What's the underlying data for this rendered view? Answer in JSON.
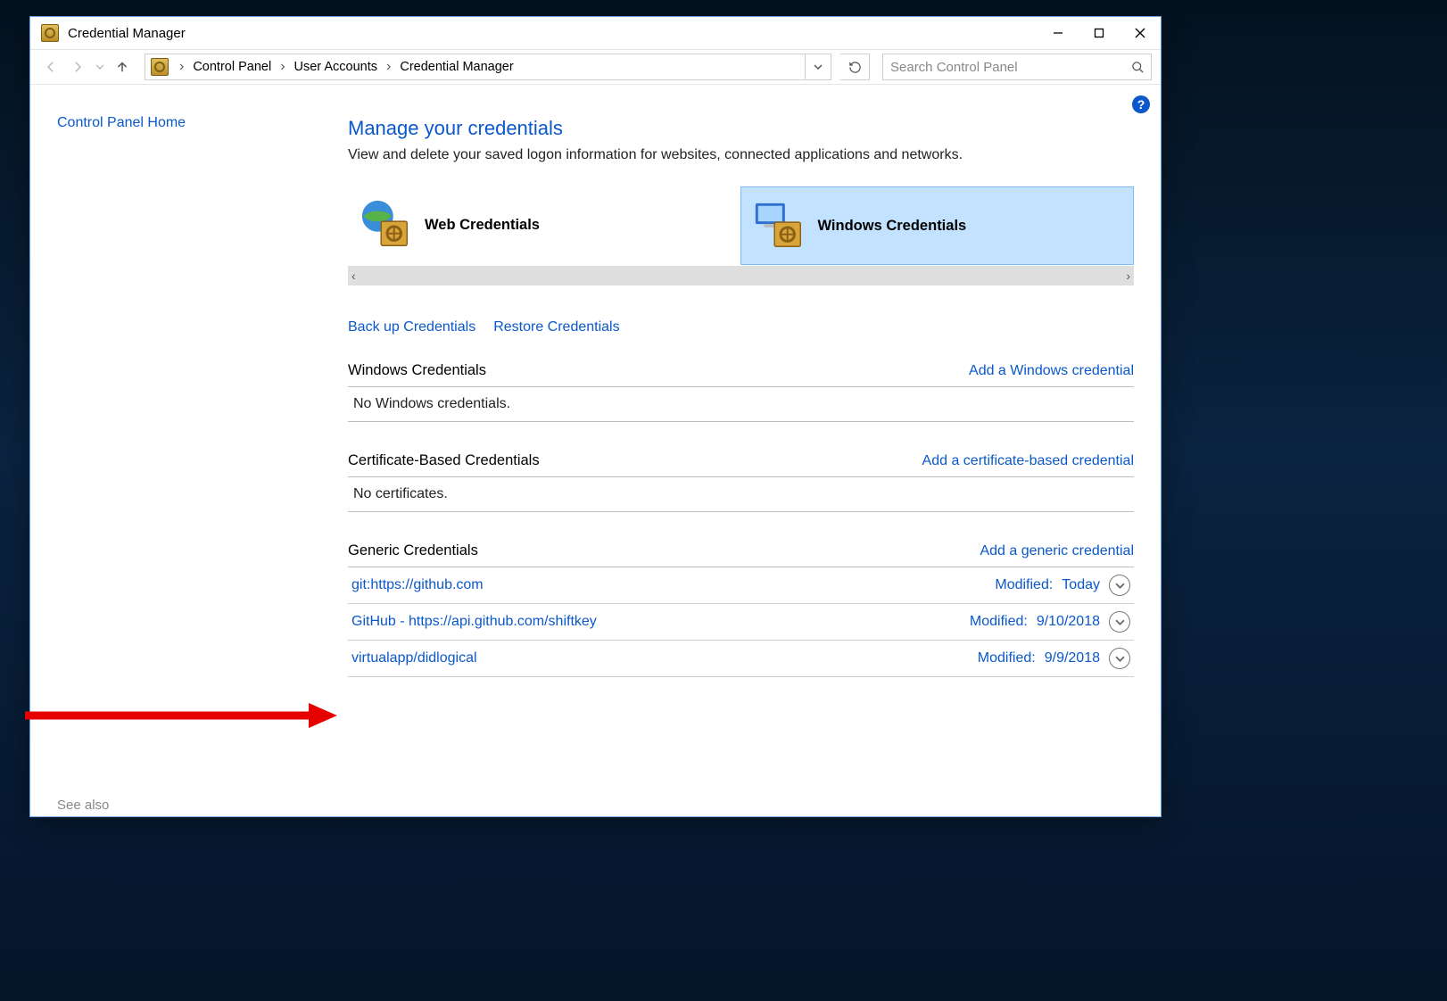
{
  "window": {
    "title": "Credential Manager"
  },
  "nav": {
    "breadcrumbs": [
      "Control Panel",
      "User Accounts",
      "Credential Manager"
    ],
    "search_placeholder": "Search Control Panel"
  },
  "sidebar": {
    "home": "Control Panel Home",
    "seealso": "See also"
  },
  "page": {
    "heading": "Manage your credentials",
    "description": "View and delete your saved logon information for websites, connected applications and networks."
  },
  "tiles": {
    "web": "Web Credentials",
    "windows": "Windows Credentials"
  },
  "actions": {
    "backup": "Back up Credentials",
    "restore": "Restore Credentials"
  },
  "sections": [
    {
      "title": "Windows Credentials",
      "add_label": "Add a Windows credential",
      "empty": "No Windows credentials."
    },
    {
      "title": "Certificate-Based Credentials",
      "add_label": "Add a certificate-based credential",
      "empty": "No certificates."
    },
    {
      "title": "Generic Credentials",
      "add_label": "Add a generic credential",
      "items": [
        {
          "name": "git:https://github.com",
          "mod_label": "Modified:",
          "mod_value": "Today"
        },
        {
          "name": "GitHub - https://api.github.com/shiftkey",
          "mod_label": "Modified:",
          "mod_value": "9/10/2018"
        },
        {
          "name": "virtualapp/didlogical",
          "mod_label": "Modified:",
          "mod_value": "9/9/2018"
        }
      ]
    }
  ],
  "help_icon": "?"
}
